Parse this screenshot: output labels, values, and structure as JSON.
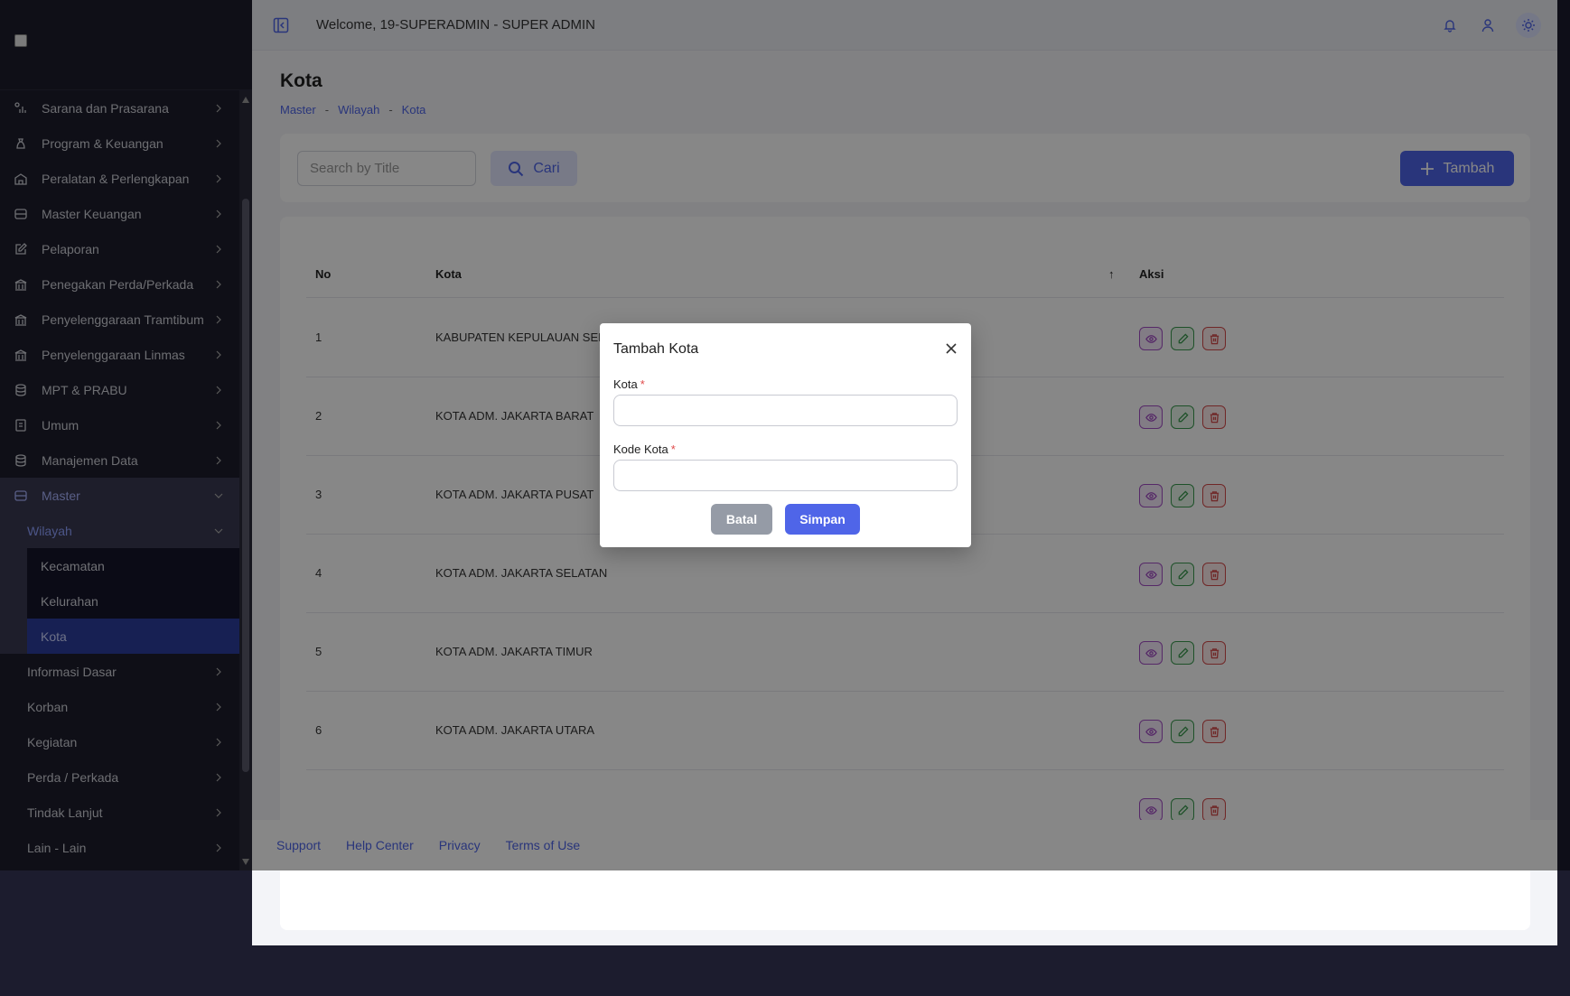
{
  "sidebar": {
    "items": [
      {
        "label": "Sarana dan Prasarana",
        "icon": "chart-icon"
      },
      {
        "label": "Program & Keuangan",
        "icon": "moneybag-icon"
      },
      {
        "label": "Peralatan & Perlengkapan",
        "icon": "building-icon"
      },
      {
        "label": "Master Keuangan",
        "icon": "database-icon"
      },
      {
        "label": "Pelaporan",
        "icon": "edit-icon"
      },
      {
        "label": "Penegakan Perda/Perkada",
        "icon": "bank-icon"
      },
      {
        "label": "Penyelenggaraan Tramtibum",
        "icon": "bank-icon"
      },
      {
        "label": "Penyelenggaraan Linmas",
        "icon": "bank-icon"
      },
      {
        "label": "MPT & PRABU",
        "icon": "database-icon"
      },
      {
        "label": "Umum",
        "icon": "document-icon"
      },
      {
        "label": "Manajemen Data",
        "icon": "database-icon"
      }
    ],
    "master": {
      "label": "Master"
    },
    "wilayah": {
      "label": "Wilayah"
    },
    "wilayah_children": [
      "Kecamatan",
      "Kelurahan",
      "Kota"
    ],
    "after": [
      "Informasi Dasar",
      "Korban",
      "Kegiatan",
      "Perda / Perkada",
      "Tindak Lanjut",
      "Lain - Lain"
    ]
  },
  "header": {
    "welcome": "Welcome, 19-SUPERADMIN - SUPER ADMIN"
  },
  "page": {
    "title": "Kota",
    "breadcrumb": [
      "Master",
      "Wilayah",
      "Kota"
    ]
  },
  "toolbar": {
    "search_placeholder": "Search by Title",
    "cari_label": "Cari",
    "tambah_label": "Tambah"
  },
  "table": {
    "headers": {
      "no": "No",
      "kota": "Kota",
      "sort_indicator": "↑",
      "aksi": "Aksi"
    },
    "rows": [
      {
        "no": "1",
        "kota": "KABUPATEN KEPULAUAN SERIBU"
      },
      {
        "no": "2",
        "kota": "KOTA ADM. JAKARTA BARAT"
      },
      {
        "no": "3",
        "kota": "KOTA ADM. JAKARTA PUSAT"
      },
      {
        "no": "4",
        "kota": "KOTA ADM. JAKARTA SELATAN"
      },
      {
        "no": "5",
        "kota": "KOTA ADM. JAKARTA TIMUR"
      },
      {
        "no": "6",
        "kota": "KOTA ADM. JAKARTA UTARA"
      }
    ]
  },
  "footer": {
    "links": [
      "Support",
      "Help Center",
      "Privacy",
      "Terms of Use"
    ]
  },
  "modal": {
    "title": "Tambah Kota",
    "field1_label": "Kota",
    "field2_label": "Kode Kota",
    "required_mark": "*",
    "field1_value": "",
    "field2_value": "",
    "batal_label": "Batal",
    "simpan_label": "Simpan"
  },
  "colors": {
    "accent": "#4f65e8",
    "sidebar_bg": "#1e1e2d",
    "view": "#a24fc4",
    "edit": "#3a9a4e",
    "delete": "#d44b4b"
  }
}
